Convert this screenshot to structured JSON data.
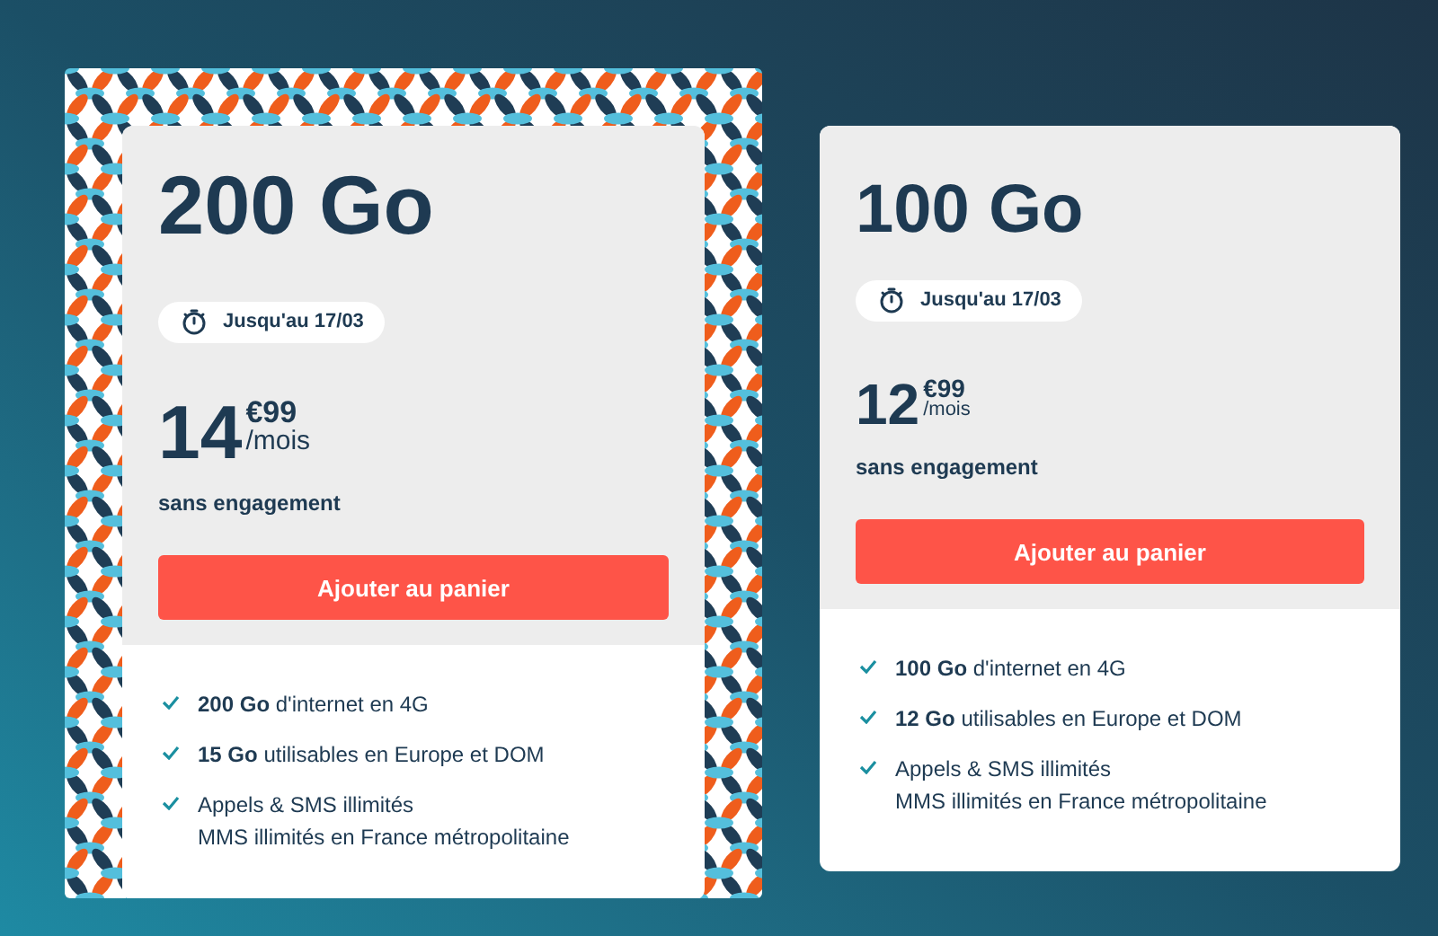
{
  "offers": [
    {
      "highlighted": true,
      "title": "200 Go",
      "badge": "Jusqu'au 17/03",
      "price_whole": "14",
      "price_cents": "€99",
      "price_period": "/mois",
      "commitment": "sans engagement",
      "button": "Ajouter au panier",
      "features": [
        {
          "text": "**200 Go** d'internet en 4G"
        },
        {
          "text": "**15 Go** utilisables en Europe et DOM"
        },
        {
          "text": "Appels & SMS illimités",
          "detail": "MMS illimités en France métropolitaine"
        }
      ]
    },
    {
      "highlighted": false,
      "title": "100 Go",
      "badge": "Jusqu'au 17/03",
      "price_whole": "12",
      "price_cents": "€99",
      "price_period": "/mois",
      "commitment": "sans engagement",
      "button": "Ajouter au panier",
      "features": [
        {
          "text": "**100 Go** d'internet en 4G"
        },
        {
          "text": "**12 Go** utilisables en Europe et DOM"
        },
        {
          "text": "Appels & SMS illimités",
          "detail": "MMS illimités en France métropolitaine"
        }
      ]
    }
  ]
}
